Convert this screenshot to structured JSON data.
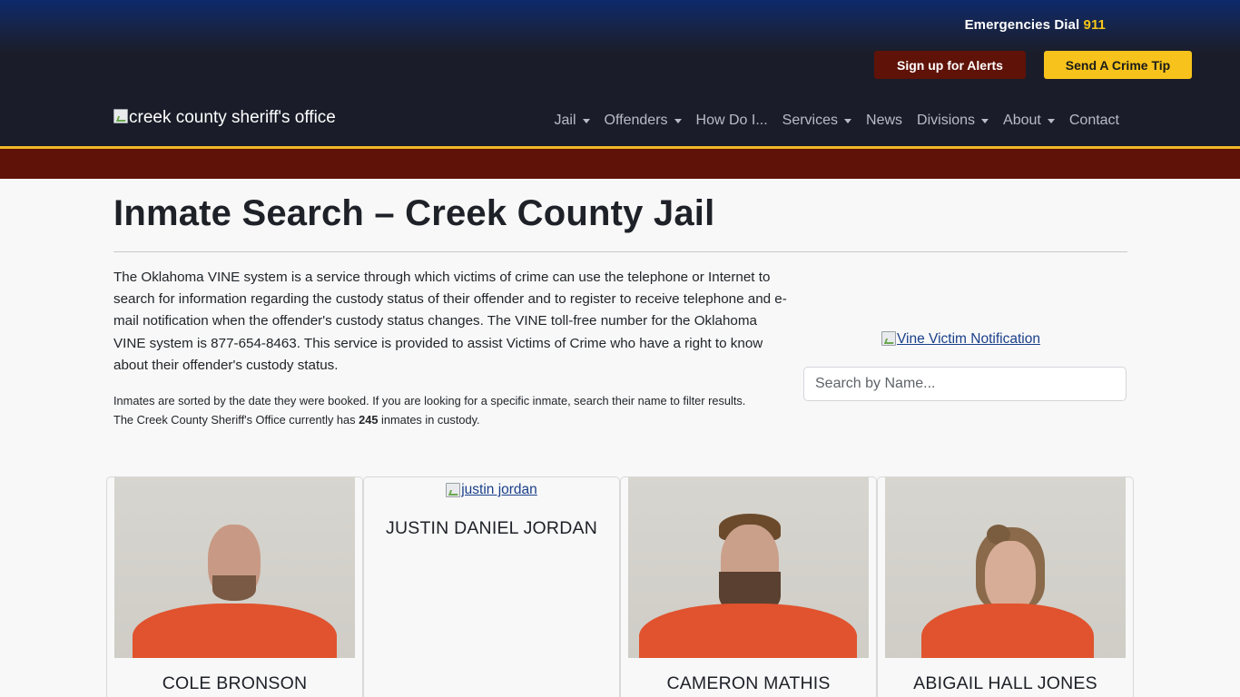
{
  "header": {
    "emergency_text": "Emergencies Dial ",
    "emergency_number": "911",
    "alerts_button": "Sign up for Alerts",
    "tip_button": "Send A Crime Tip",
    "logo_alt": "creek county sheriff's office",
    "colors": {
      "header_bg": "#1a1d29",
      "gold": "#f2b824",
      "maroon": "#5f1207",
      "tip_yellow": "#f7c21b"
    }
  },
  "nav": {
    "items": [
      {
        "label": "Jail",
        "dropdown": true
      },
      {
        "label": "Offenders",
        "dropdown": true
      },
      {
        "label": "How Do I...",
        "dropdown": false
      },
      {
        "label": "Services",
        "dropdown": true
      },
      {
        "label": "News",
        "dropdown": false
      },
      {
        "label": "Divisions",
        "dropdown": true
      },
      {
        "label": "About",
        "dropdown": true
      },
      {
        "label": "Contact",
        "dropdown": false
      }
    ]
  },
  "main": {
    "title": "Inmate Search – Creek County Jail",
    "intro": "The Oklahoma VINE system is a service through which victims of crime can use the telephone or Internet to search for information regarding the custody status of their offender and to register to receive telephone and e-mail notification when the offender's custody status changes. The VINE toll-free number for the Oklahoma VINE system is 877-654-8463. This service is provided to assist Victims of Crime who have a right to know about their offender's custody status.",
    "note_line1": "Inmates are sorted by the date they were booked. If you are looking for a specific inmate, search their name to filter results.",
    "note_prefix": "The Creek County Sheriff's Office currently has ",
    "inmate_count": "245",
    "note_suffix": " inmates in custody.",
    "vine_link_alt": "Vine Victim Notification",
    "search_placeholder": "Search by Name..."
  },
  "inmates": [
    {
      "name": "COLE BRONSON",
      "photo": true
    },
    {
      "name": "JUSTIN DANIEL JORDAN",
      "photo": false,
      "img_alt": "justin jordan"
    },
    {
      "name": "CAMERON MATHIS",
      "photo": true
    },
    {
      "name": "ABIGAIL HALL JONES",
      "photo": true
    }
  ]
}
